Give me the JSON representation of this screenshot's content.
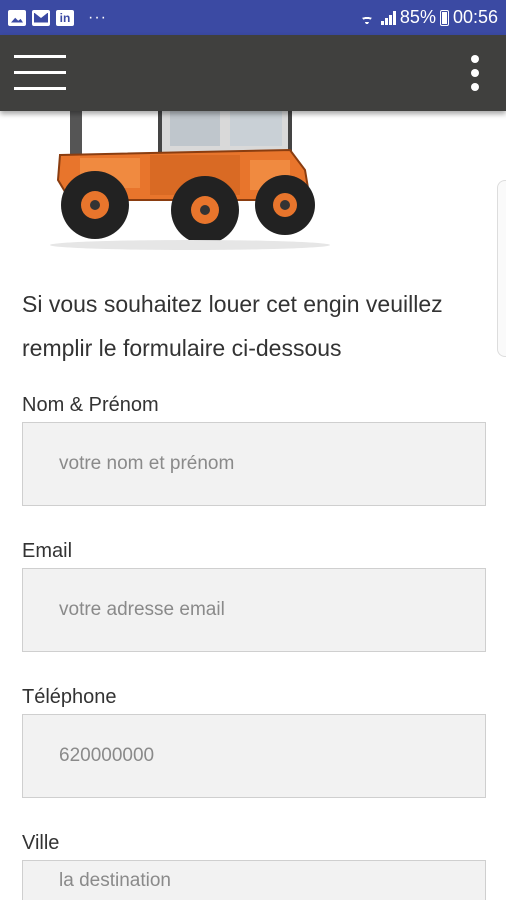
{
  "status_bar": {
    "battery": "85%",
    "time": "00:56",
    "dots": "···",
    "icons": [
      "image-icon",
      "mail-icon",
      "linkedin-icon",
      "wifi-icon",
      "signal-icon",
      "battery-icon"
    ],
    "linkedin_text": "in"
  },
  "toolbar": {
    "icons": [
      "menu-icon",
      "more-vert-icon"
    ]
  },
  "intro": "Si vous souhaitez louer cet engin veuillez remplir le formulaire ci-dessous",
  "form": {
    "fields": [
      {
        "label": "Nom & Prénom",
        "placeholder": "votre nom et prénom"
      },
      {
        "label": "Email",
        "placeholder": "votre adresse email"
      },
      {
        "label": "Téléphone",
        "placeholder": "620000000"
      },
      {
        "label": "Ville",
        "placeholder": "la destination"
      }
    ]
  },
  "colors": {
    "status_bar": "#3b4aa3",
    "toolbar": "#40403e",
    "machine_orange": "#e8752c"
  }
}
